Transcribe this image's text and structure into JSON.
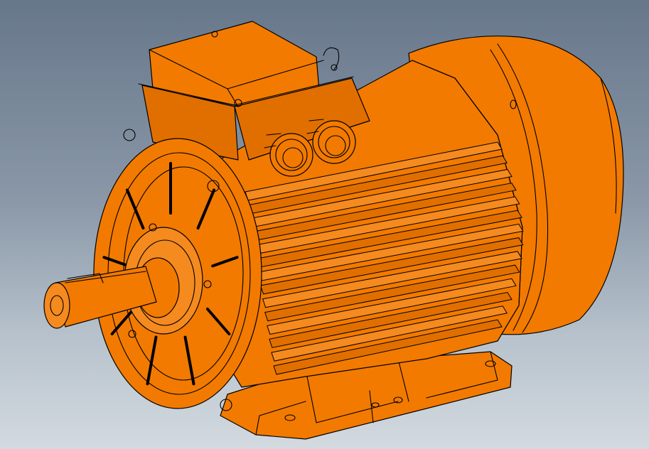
{
  "viewer": {
    "subject": "",
    "background_top": "#67778a",
    "background_bottom": "#d3dae0"
  },
  "model": {
    "body_color": "#f27a00",
    "body_shade": "#e06f00",
    "body_light": "#f58a1f",
    "edge_color": "#000000",
    "cooling_fin_count": 14,
    "cable_gland_count": 2,
    "cover_rib_count": 9,
    "mounting_hole_count": 4
  }
}
